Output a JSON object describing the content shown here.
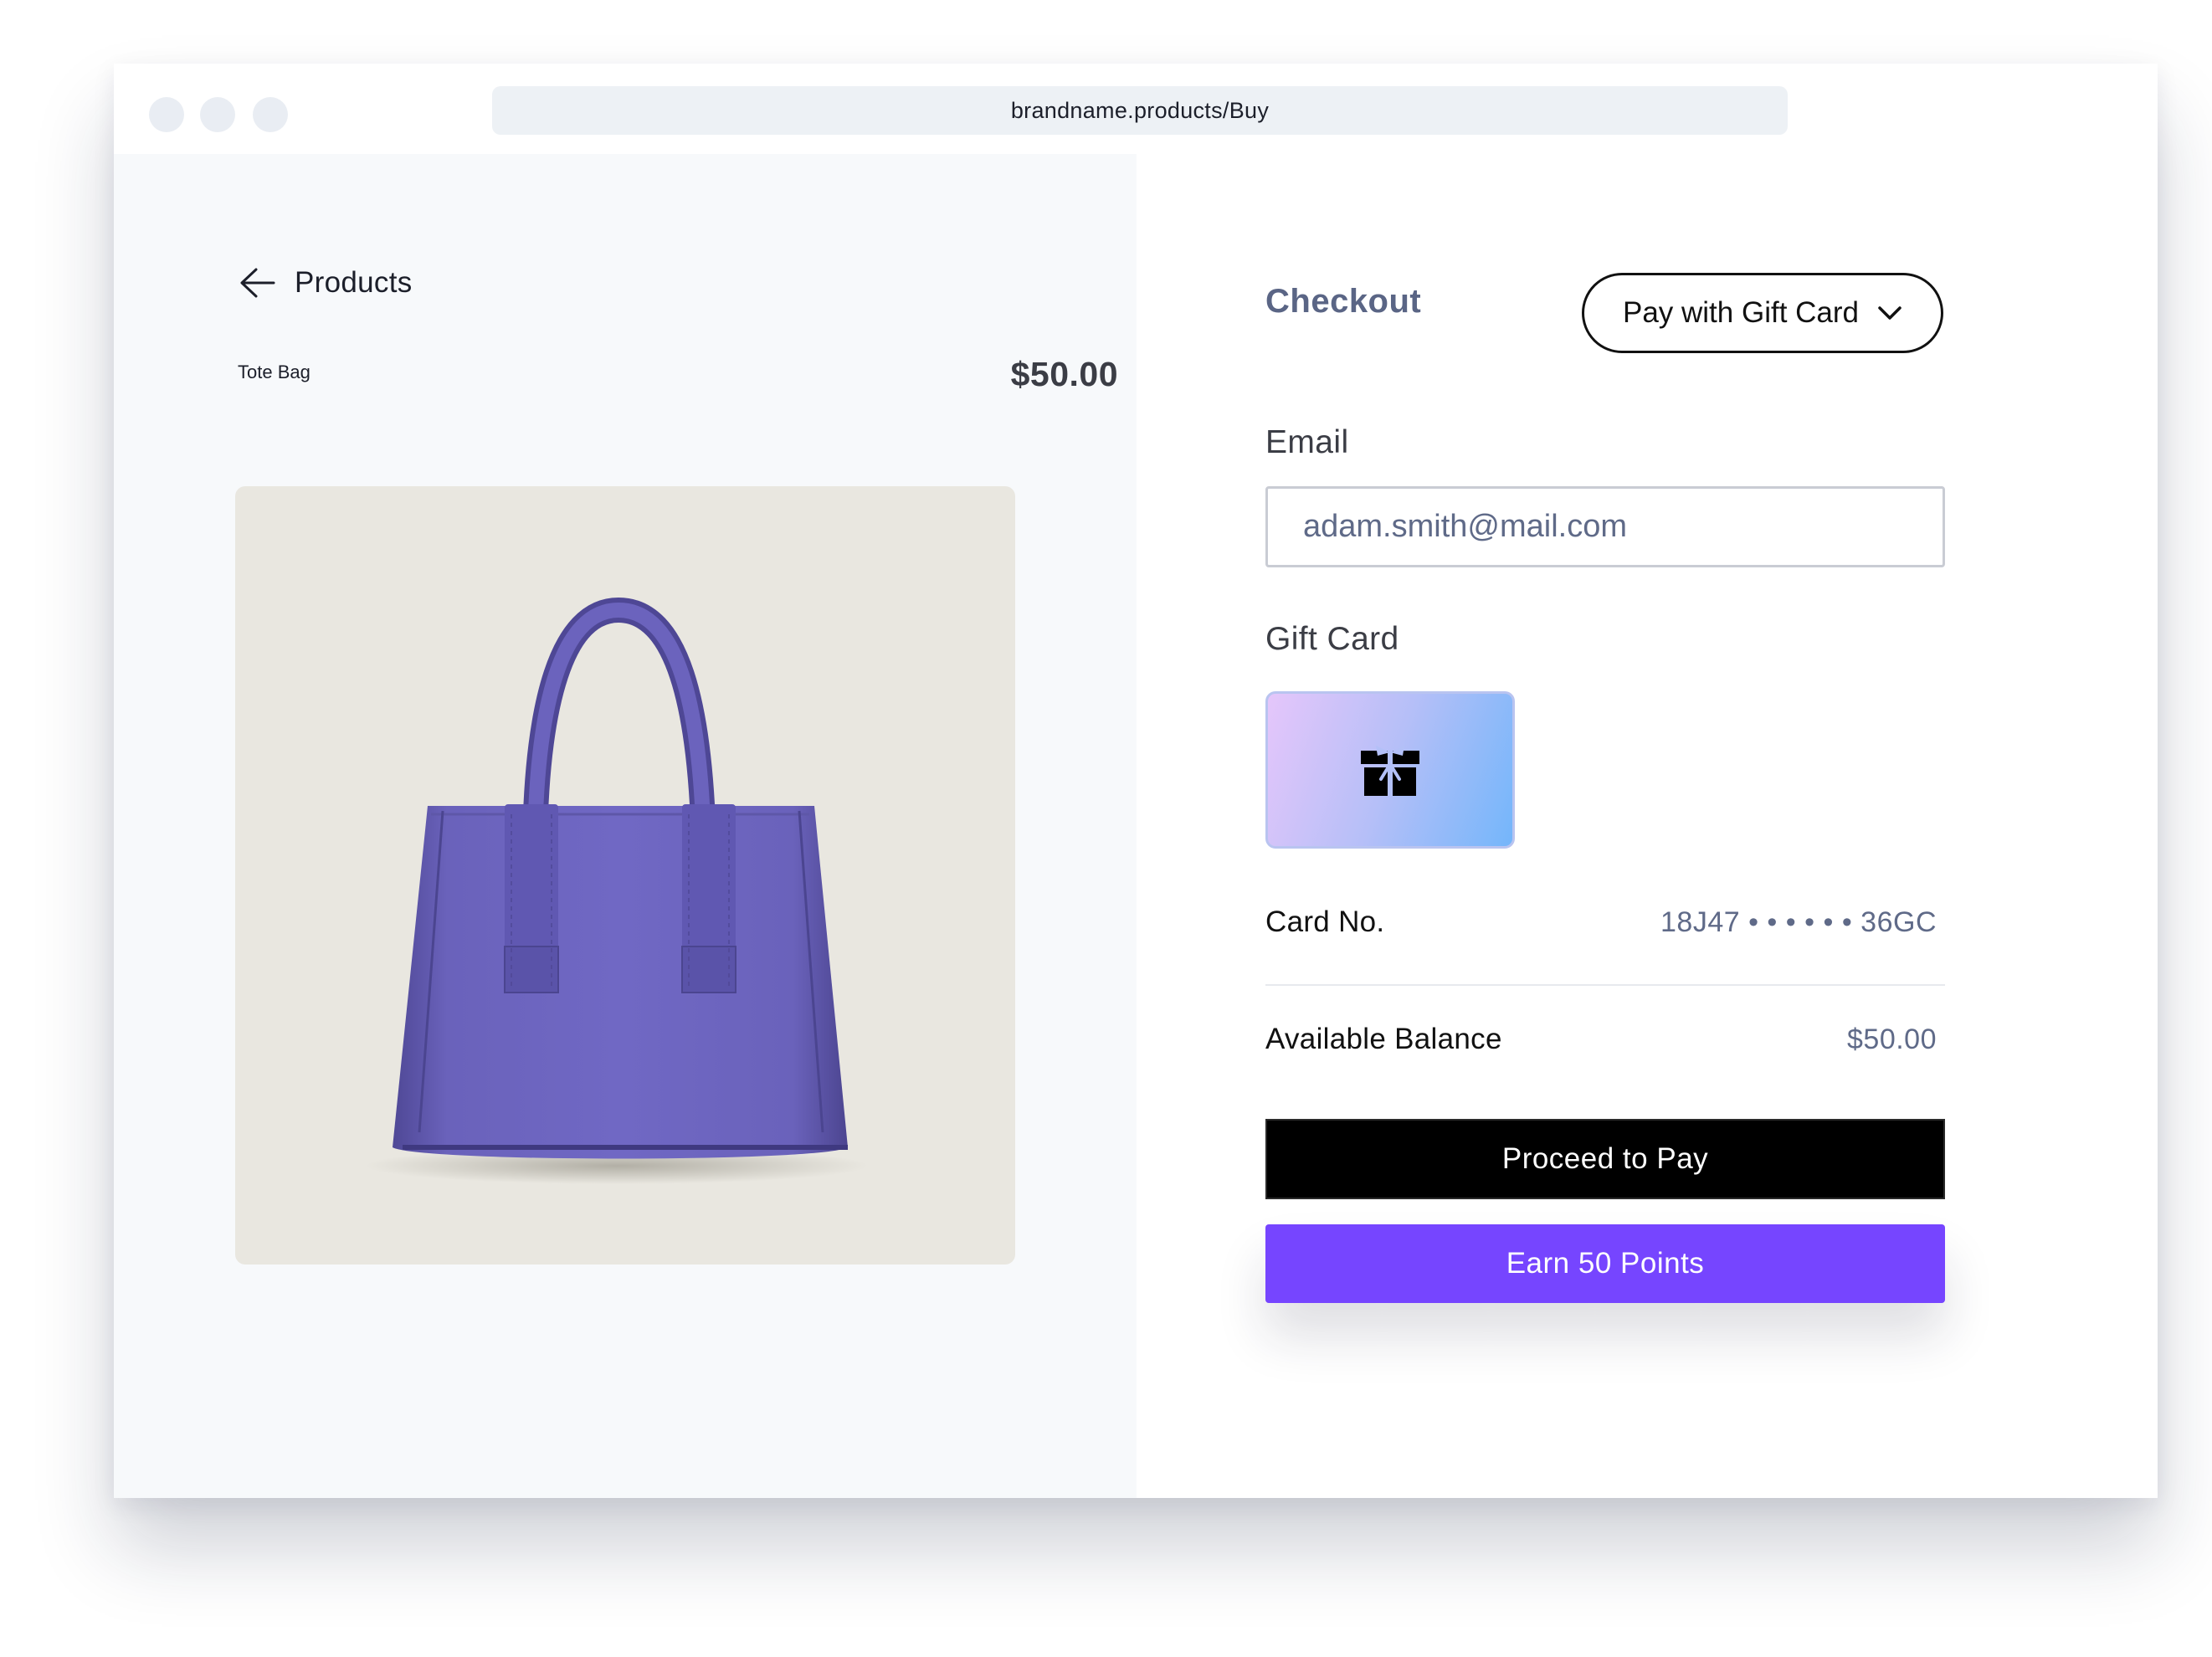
{
  "browser": {
    "url": "brandname.products/Buy"
  },
  "product": {
    "back_label": "Products",
    "name": "Tote Bag",
    "price": "$50.00",
    "image_icon": "purple-tote-bag",
    "image_bg": "#e9e7e0",
    "bag_color": "#6b63bd"
  },
  "checkout": {
    "title": "Checkout",
    "payment_method": "Pay with Gift Card",
    "email_label": "Email",
    "email_value": "adam.smith@mail.com",
    "gift_card_label": "Gift Card",
    "gift_card_icon": "gift-box-icon",
    "card_no_label": "Card No.",
    "card_no_value": "18J47 • • • • • • 36GC",
    "balance_label": "Available Balance",
    "balance_value": "$50.00",
    "proceed_button": "Proceed to Pay",
    "earn_button": "Earn 50 Points"
  },
  "colors": {
    "accent_purple": "#7645ff",
    "checkout_title": "#5a6585",
    "primary_button": "#000000"
  }
}
